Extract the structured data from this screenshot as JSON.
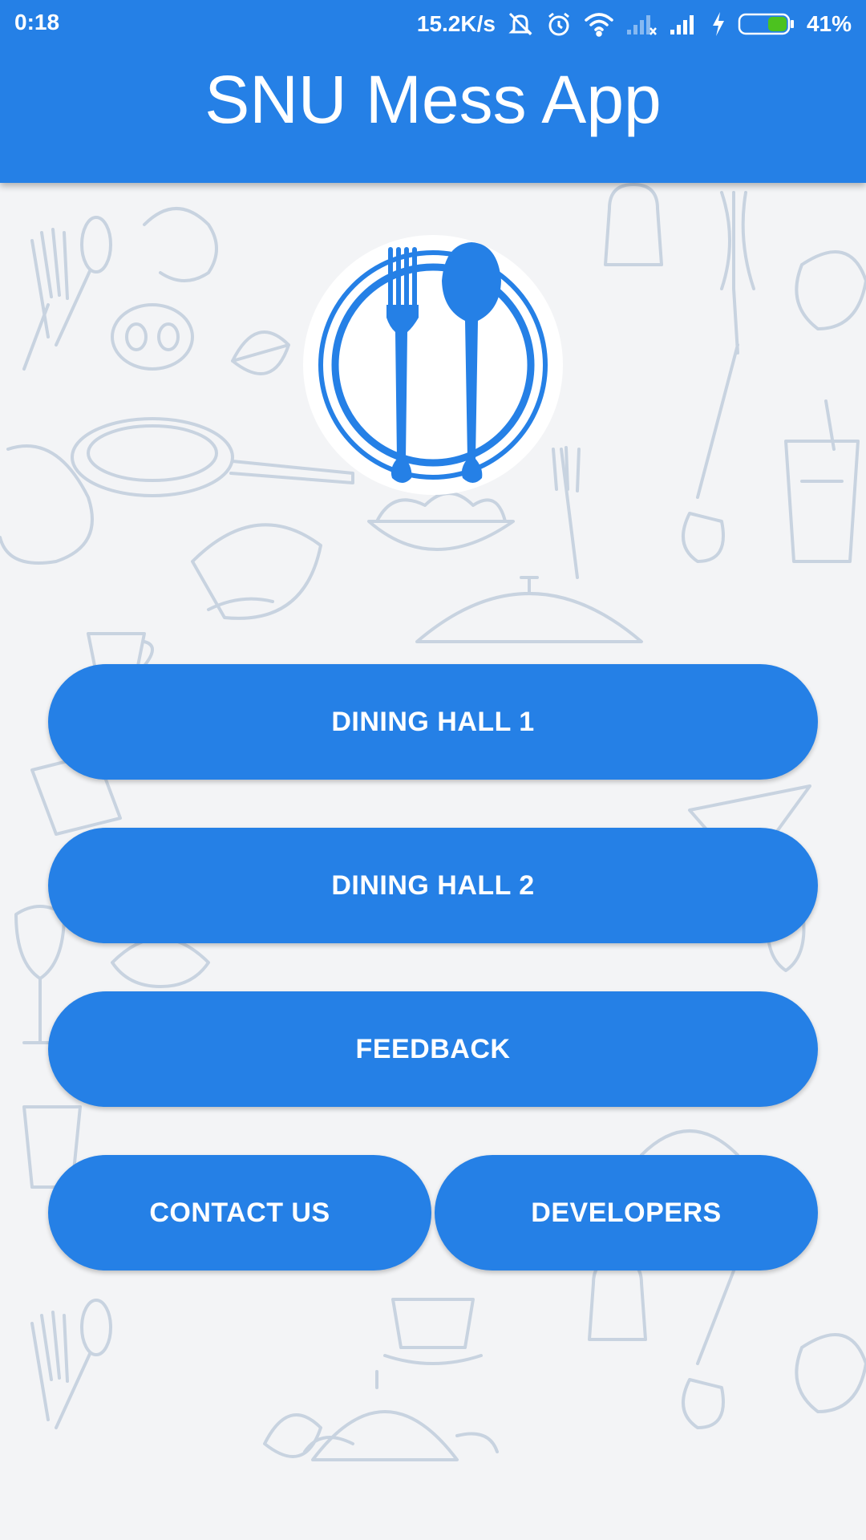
{
  "status_bar": {
    "time": "0:18",
    "network_speed": "15.2K/s",
    "battery_percent": "41%",
    "battery_level": 0.41,
    "icons": [
      "silent-icon",
      "alarm-icon",
      "wifi-icon",
      "no-signal-icon",
      "signal-icon",
      "charging-icon",
      "battery-icon"
    ]
  },
  "app_bar": {
    "title": "SNU Mess App",
    "color": "#2580e6"
  },
  "logo": {
    "icon": "fork-spoon-plate-icon"
  },
  "buttons": {
    "dining_hall_1": "DINING HALL 1",
    "dining_hall_2": "DINING HALL 2",
    "feedback": "FEEDBACK",
    "contact_us": "CONTACT US",
    "developers": "DEVELOPERS"
  },
  "colors": {
    "accent": "#2580e6",
    "background": "#f3f4f6",
    "doodle": "#c8d3e0"
  }
}
